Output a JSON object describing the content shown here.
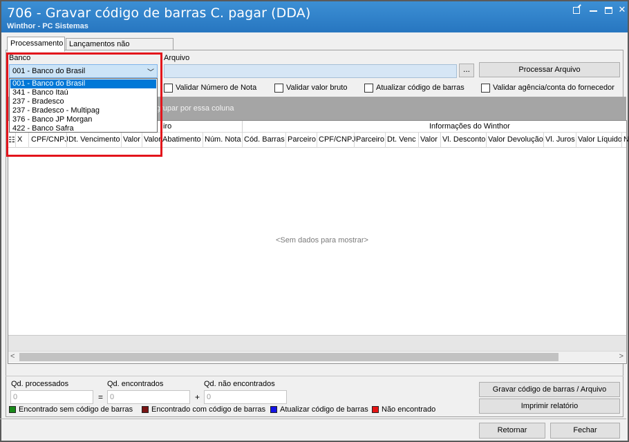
{
  "window": {
    "title": "706 - Gravar código de barras C. pagar (DDA)",
    "subtitle": "Winthor - PC Sistemas"
  },
  "tabs": [
    {
      "label": "Processamento",
      "active": true
    },
    {
      "label": "Lançamentos não encontrados",
      "active": false
    }
  ],
  "form": {
    "banco_label": "Banco",
    "banco_selected": "001 - Banco do Brasil",
    "arquivo_label": "Arquivo",
    "arquivo_value": "",
    "browse_label": "...",
    "processar_label": "Processar Arquivo"
  },
  "dropdown_options": [
    "001 - Banco do Brasil",
    "341 - Banco Itaú",
    "237 - Bradesco",
    "237 - Bradesco - Multipag",
    "376 - Banco JP Morgan",
    "422 - Banco Safra"
  ],
  "checkboxes": [
    {
      "label": "Validar Número de Nota",
      "checked": false
    },
    {
      "label": "Validar valor bruto",
      "checked": false
    },
    {
      "label": "Atualizar código de barras",
      "checked": false
    },
    {
      "label": "Validar agência/conta do fornecedor",
      "checked": false
    }
  ],
  "grid": {
    "group_panel_text": "grupar por essa coluna",
    "band_left_fragment": "iro",
    "band_right": "Informações do Winthor",
    "columns": [
      "X",
      "CPF/CNPJ",
      "Dt. Vencimento",
      "Valor",
      "Valor",
      "Abatimento",
      "Núm. Nota",
      "Cód. Barras",
      "Parceiro",
      "CPF/CNPJ",
      "Parceiro",
      "Dt. Venc",
      "Valor",
      "Vl. Desconto",
      "Valor Devolução",
      "Vl. Juros",
      "Valor Líquido",
      "N"
    ],
    "empty_text": "<Sem dados para mostrar>"
  },
  "summary": {
    "processados_label": "Qd. processados",
    "processados_value": "0",
    "encontrados_label": "Qd. encontrados",
    "encontrados_value": "0",
    "nao_encontrados_label": "Qd. não encontrados",
    "nao_encontrados_value": "0",
    "equals": "=",
    "plus": "+"
  },
  "legend": [
    {
      "label": "Encontrado sem código de barras",
      "color": "#1a8a1a"
    },
    {
      "label": "Encontrado com código de barras",
      "color": "#7a1414"
    },
    {
      "label": "Atualizar código de barras",
      "color": "#1414e6"
    },
    {
      "label": "Não encontrado",
      "color": "#e61414"
    }
  ],
  "buttons": {
    "gravar": "Gravar código de barras / Arquivo",
    "imprimir": "Imprimir relatório",
    "retornar": "Retornar",
    "fechar": "Fechar"
  },
  "icons": {
    "title_edit": "edit-window-icon",
    "minimize": "minimize-icon",
    "maximize": "maximize-icon",
    "close": "close-icon",
    "column_chooser": "column-chooser-icon"
  }
}
